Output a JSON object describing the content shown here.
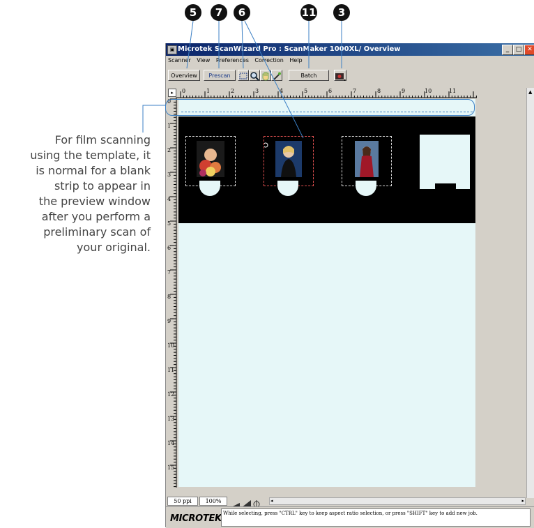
{
  "callouts": [
    "5",
    "7",
    "6",
    "11",
    "3"
  ],
  "note": {
    "lines": [
      "For film scanning",
      "using the template, it",
      "is normal for a blank",
      "strip to appear in",
      "the preview window",
      "after you perform a",
      "preliminary scan of",
      "your original."
    ]
  },
  "window": {
    "title": "Microtek ScanWizard Pro : ScanMaker 1000XL/ Overview",
    "app_icon": "scanner-app-icon",
    "controls": [
      "minimize",
      "maximize",
      "close"
    ]
  },
  "menu": [
    "Scanner",
    "View",
    "Preferences",
    "Correction",
    "Help"
  ],
  "toolbar": {
    "overview_label": "Overview",
    "prescan_label": "Prescan",
    "batch_label": "Batch",
    "tools": [
      "selection-frame-icon",
      "magnifier-icon",
      "hand-icon",
      "eyedropper-icon"
    ],
    "device_icon": "scan-device-icon"
  },
  "ruler": {
    "horizontal": [
      "0",
      "1",
      "2",
      "3",
      "4",
      "5",
      "6",
      "7",
      "8",
      "9",
      "10",
      "11"
    ],
    "vertical": [
      "0",
      "1",
      "2",
      "3",
      "4",
      "5",
      "6",
      "7",
      "8",
      "9",
      "10",
      "11",
      "12",
      "13",
      "14",
      "15"
    ]
  },
  "status": {
    "resolution": "50 ppi",
    "zoom": "100%",
    "logo": "MICROTEK",
    "hint": "While selecting, press \"CTRL\" key to keep aspect ratio selection, or press \"SHIFT\" key to add new job."
  },
  "colors": {
    "preview_bg": "#e6f7f8",
    "film": "#000000",
    "title_bar": "#0a246a",
    "template_outline": "#3b7fc4"
  }
}
